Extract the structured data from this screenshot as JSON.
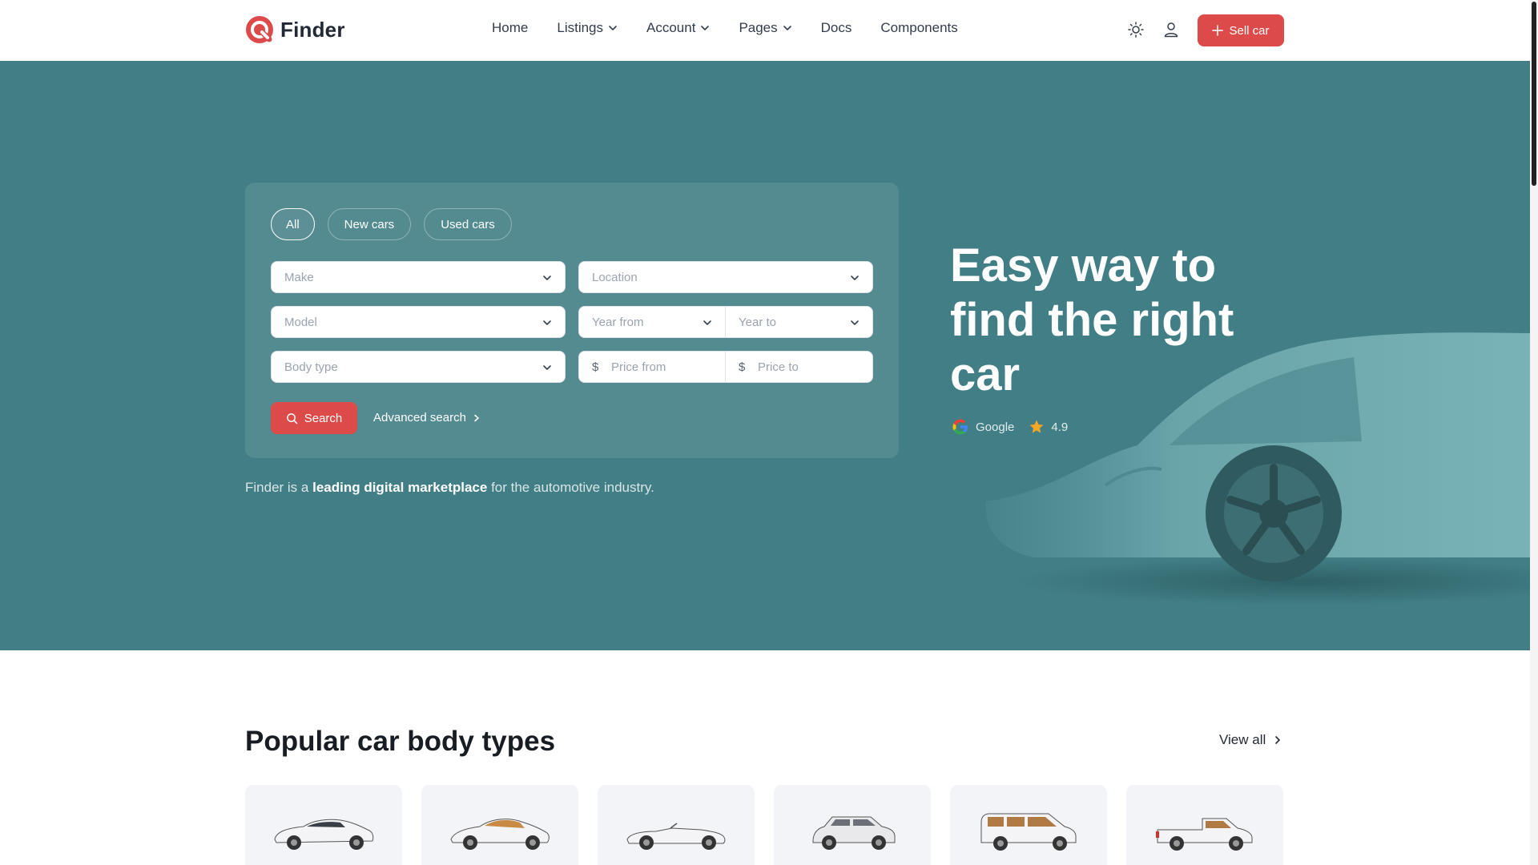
{
  "header": {
    "brand": "Finder",
    "nav": [
      {
        "label": "Home",
        "has_menu": false
      },
      {
        "label": "Listings",
        "has_menu": true
      },
      {
        "label": "Account",
        "has_menu": true
      },
      {
        "label": "Pages",
        "has_menu": true
      },
      {
        "label": "Docs",
        "has_menu": false
      },
      {
        "label": "Components",
        "has_menu": false
      }
    ],
    "icons": [
      "sun-icon",
      "user-icon"
    ],
    "sell_button": "Sell car"
  },
  "hero": {
    "tabs": [
      "All",
      "New cars",
      "Used cars"
    ],
    "active_tab": "All",
    "fields": {
      "make": "Make",
      "location": "Location",
      "model": "Model",
      "year_from": "Year from",
      "year_to": "Year to",
      "body_type": "Body type",
      "price_from": "Price from",
      "price_to": "Price to"
    },
    "currency_symbol": "$",
    "search_button": "Search",
    "advanced_search": "Advanced search",
    "tagline_pre": "Finder is a ",
    "tagline_bold": "leading digital marketplace",
    "tagline_post": " for the automotive industry.",
    "title": "Easy way to find the right car",
    "rating_source": "Google",
    "rating_value": "4.9"
  },
  "body_types": {
    "title": "Popular car body types",
    "view_all": "View all",
    "items": [
      "sedan-icon",
      "coupe-icon",
      "convertible-icon",
      "suv-icon",
      "minivan-icon",
      "pickup-icon"
    ]
  },
  "colors": {
    "accent": "#dd4a4a",
    "hero_bg": "#417e85",
    "text_dark": "#181d24"
  }
}
